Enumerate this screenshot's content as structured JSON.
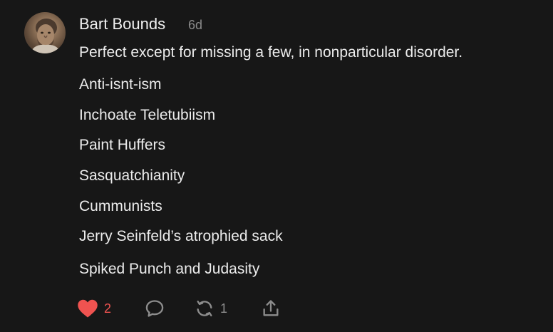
{
  "comment": {
    "author": "Bart Bounds",
    "timestamp": "6d",
    "avatar_icon": "avatar-icon",
    "lines": [
      "Perfect except for missing a few, in nonparticular disorder.",
      "Anti-isnt-ism",
      "Inchoate Teletubiism",
      "Paint Huffers",
      "Sasquatchianity",
      "Cummunists",
      "Jerry Seinfeld’s atrophied sack",
      "Spiked Punch and Judasity"
    ]
  },
  "actions": {
    "like_count": "2",
    "restack_count": "1",
    "icons": {
      "like": "heart-icon",
      "reply": "comment-icon",
      "restack": "restack-icon",
      "share": "share-icon"
    },
    "colors": {
      "like": "#ef5350",
      "muted": "#8d8d8d"
    }
  }
}
